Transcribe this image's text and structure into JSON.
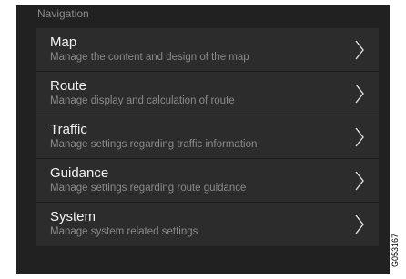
{
  "header": {
    "title": "Navigation"
  },
  "menu": {
    "items": [
      {
        "title": "Map",
        "subtitle": "Manage the content and design of the map",
        "icon": "chevron-right-icon"
      },
      {
        "title": "Route",
        "subtitle": "Manage display and calculation of route",
        "icon": "chevron-right-icon"
      },
      {
        "title": "Traffic",
        "subtitle": "Manage settings regarding traffic information",
        "icon": "chevron-right-icon"
      },
      {
        "title": "Guidance",
        "subtitle": "Manage settings regarding route guidance",
        "icon": "chevron-right-icon"
      },
      {
        "title": "System",
        "subtitle": "Manage system related settings",
        "icon": "chevron-right-icon"
      }
    ]
  },
  "figure_id": "G053167",
  "colors": {
    "screen_bg": "#212121",
    "panel_bg": "#2c2c2c",
    "title_text": "#f2f2f2",
    "subtitle_text": "#8a8a8a"
  }
}
